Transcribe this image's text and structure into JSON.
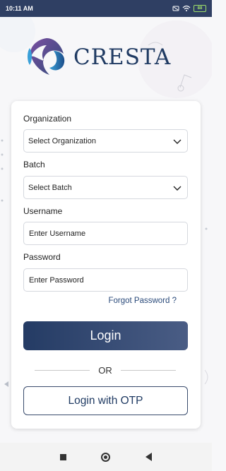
{
  "status_bar": {
    "time": "10:11 AM",
    "battery": "88"
  },
  "brand": {
    "name": "CRESTA"
  },
  "form": {
    "organization_label": "Organization",
    "organization_value": "Select Organization",
    "batch_label": "Batch",
    "batch_value": "Select Batch",
    "username_label": "Username",
    "username_placeholder": "Enter Username",
    "password_label": "Password",
    "password_placeholder": "Enter Password",
    "forgot_password": "Forgot Password ?",
    "login_button": "Login",
    "or_text": "OR",
    "otp_button": "Login with OTP"
  },
  "colors": {
    "primary": "#243b64",
    "status_bar": "#2f3f63",
    "logo_accent": "#5e4a8c"
  }
}
